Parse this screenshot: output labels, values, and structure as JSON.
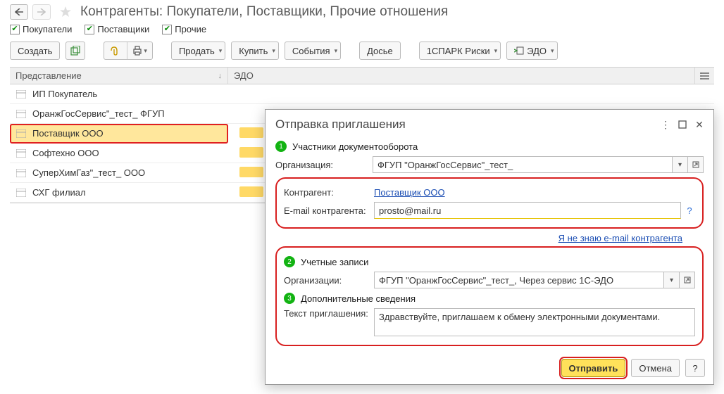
{
  "header": {
    "title": "Контрагенты: Покупатели, Поставщики, Прочие отношения"
  },
  "filters": [
    {
      "label": "Покупатели",
      "checked": true
    },
    {
      "label": "Поставщики",
      "checked": true
    },
    {
      "label": "Прочие",
      "checked": true
    }
  ],
  "toolbar": {
    "create": "Создать",
    "sell": "Продать",
    "buy": "Купить",
    "events": "События",
    "dossier": "Досье",
    "spark": "1СПАРК Риски",
    "edo": "ЭДО"
  },
  "table": {
    "col_presentation": "Представление",
    "col_edo": "ЭДО",
    "rows": [
      {
        "text": "ИП Покупатель"
      },
      {
        "text": "ОранжГосСервис\"_тест_ ФГУП"
      },
      {
        "text": "Поставщик ООО"
      },
      {
        "text": "Софтехно ООО"
      },
      {
        "text": "СуперХимГаз\"_тест_ ООО"
      },
      {
        "text": "СХГ филиал"
      }
    ]
  },
  "popup": {
    "title": "Отправка приглашения",
    "step1": "Участники документооборота",
    "org_lbl": "Организация:",
    "org_val": "ФГУП \"ОранжГосСервис\"_тест_",
    "contr_lbl": "Контрагент:",
    "contr_val": "Поставщик ООО",
    "email_lbl": "E-mail контрагента:",
    "email_val": "prosto@mail.ru",
    "no_email_link": "Я не знаю e-mail контрагента",
    "step2": "Учетные записи",
    "org2_lbl": "Организации:",
    "org2_val": "ФГУП \"ОранжГосСервис\"_тест_, Через сервис 1С-ЭДО",
    "step3": "Дополнительные сведения",
    "inv_lbl": "Текст приглашения:",
    "inv_text": "Здравствуйте, приглашаем к обмену электронными документами.",
    "send": "Отправить",
    "cancel": "Отмена",
    "help": "?"
  }
}
